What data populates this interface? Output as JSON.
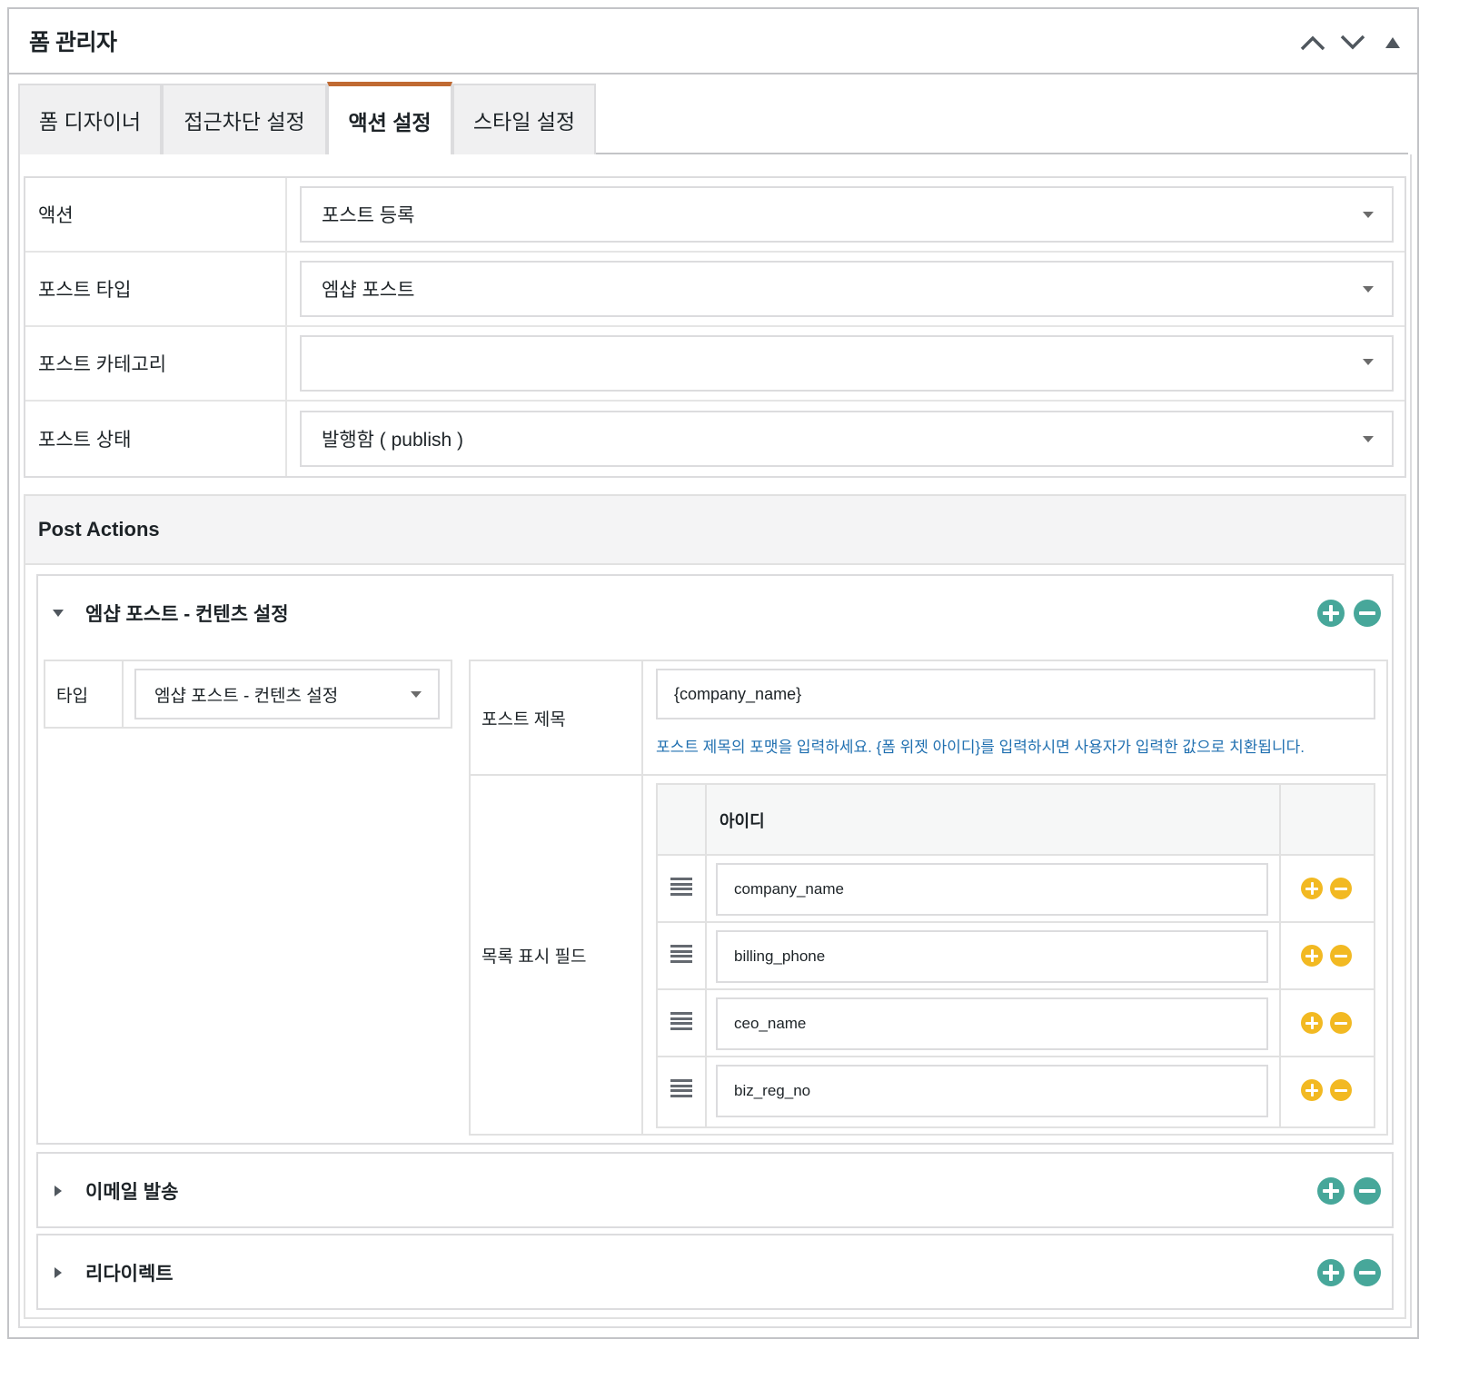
{
  "panel": {
    "title": "폼 관리자"
  },
  "tabs": [
    {
      "label": "폼 디자이너",
      "active": false
    },
    {
      "label": "접근차단 설정",
      "active": false
    },
    {
      "label": "액션 설정",
      "active": true
    },
    {
      "label": "스타일 설정",
      "active": false
    }
  ],
  "settings": [
    {
      "label": "액션",
      "value": "포스트 등록"
    },
    {
      "label": "포스트 타입",
      "value": "엠샵 포스트"
    },
    {
      "label": "포스트 카테고리",
      "value": ""
    },
    {
      "label": "포스트 상태",
      "value": "발행함 ( publish )"
    }
  ],
  "post_actions": {
    "title": "Post Actions",
    "items": [
      {
        "title": "엠샵 포스트 - 컨텐츠 설정",
        "expanded": true,
        "type_label": "타입",
        "type_value": "엠샵 포스트 - 컨텐츠 설정",
        "post_title_label": "포스트 제목",
        "post_title_value": "{company_name}",
        "post_title_hint": "포스트 제목의 포맷을 입력하세요. {폼 위젯 아이디}를 입력하시면 사용자가 입력한 값으로 치환됩니다.",
        "list_fields_label": "목록 표시 필드",
        "list_fields_header": "아이디",
        "list_fields": [
          "company_name",
          "billing_phone",
          "ceo_name",
          "biz_reg_no"
        ]
      },
      {
        "title": "이메일 발송",
        "expanded": false
      },
      {
        "title": "리다이렉트",
        "expanded": false
      }
    ]
  },
  "colors": {
    "active_tab_accent": "#c06a32",
    "add_remove_primary": "#47a79a",
    "add_remove_row": "#f2b922",
    "hint_text": "#2271b1"
  },
  "icons": {
    "header": [
      "chevron-up-icon",
      "chevron-down-icon",
      "triangle-up-icon"
    ],
    "accordion_toggle": "caret-icon",
    "add": "plus-circle-icon",
    "remove": "minus-circle-icon",
    "drag": "drag-handle-icon"
  }
}
